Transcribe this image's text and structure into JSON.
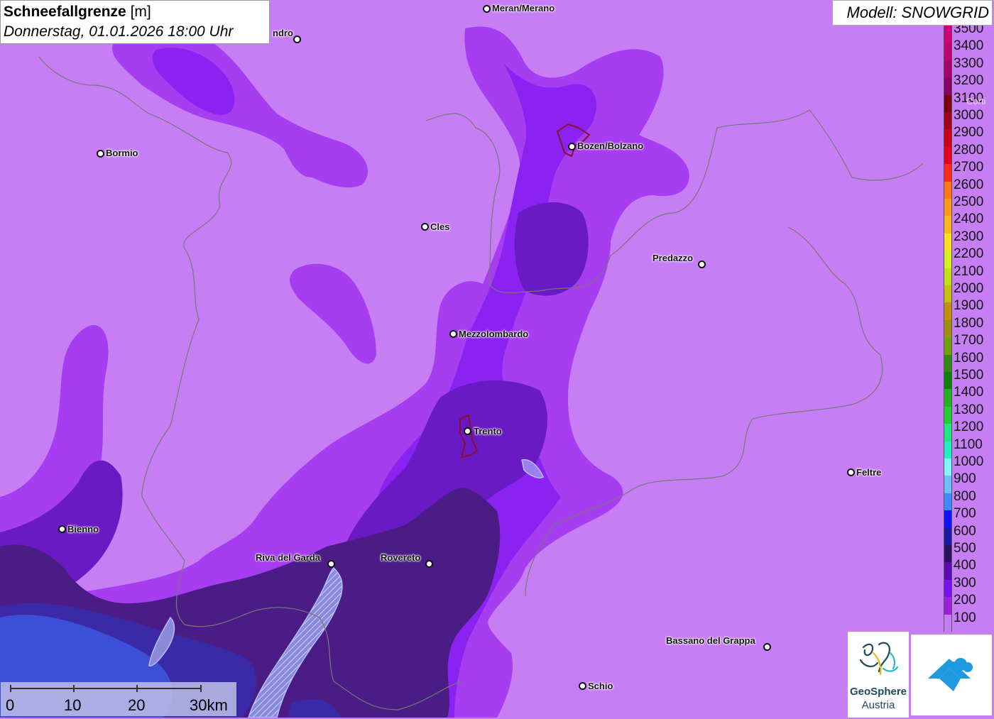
{
  "title": {
    "param_bold": "Schneefallgrenze",
    "param_unit": "[m]",
    "datetime": "Donnerstag, 01.01.2026 18:00 Uhr"
  },
  "model": "Modell: SNOWGRID",
  "legend": [
    {
      "label": "3500",
      "color": "#d1007a"
    },
    {
      "label": "3400",
      "color": "#c2006e"
    },
    {
      "label": "3300",
      "color": "#a8006a"
    },
    {
      "label": "3200",
      "color": "#8a0060"
    },
    {
      "label": "3100",
      "color": "#7a0010"
    },
    {
      "label": "3000",
      "color": "#a00018"
    },
    {
      "label": "2900",
      "color": "#c8001c"
    },
    {
      "label": "2800",
      "color": "#e60020"
    },
    {
      "label": "2700",
      "color": "#ff2a1a"
    },
    {
      "label": "2600",
      "color": "#ff7a10"
    },
    {
      "label": "2500",
      "color": "#ff9a18"
    },
    {
      "label": "2400",
      "color": "#ffb820"
    },
    {
      "label": "2300",
      "color": "#ffe020"
    },
    {
      "label": "2200",
      "color": "#d8f020"
    },
    {
      "label": "2100",
      "color": "#c0e018"
    },
    {
      "label": "2000",
      "color": "#c8c010"
    },
    {
      "label": "1900",
      "color": "#c09010"
    },
    {
      "label": "1800",
      "color": "#a09010"
    },
    {
      "label": "1700",
      "color": "#70a010"
    },
    {
      "label": "1600",
      "color": "#308a10"
    },
    {
      "label": "1500",
      "color": "#10800a"
    },
    {
      "label": "1400",
      "color": "#20b020"
    },
    {
      "label": "1300",
      "color": "#20d030"
    },
    {
      "label": "1200",
      "color": "#20e880"
    },
    {
      "label": "1100",
      "color": "#20f0c0"
    },
    {
      "label": "1000",
      "color": "#80f8ff"
    },
    {
      "label": "900",
      "color": "#70c0ff"
    },
    {
      "label": "800",
      "color": "#3a8cff"
    },
    {
      "label": "700",
      "color": "#1010ff"
    },
    {
      "label": "600",
      "color": "#1a1aa0"
    },
    {
      "label": "500",
      "color": "#2a1060"
    },
    {
      "label": "400",
      "color": "#5a0ab0"
    },
    {
      "label": "300",
      "color": "#7a10f0"
    },
    {
      "label": "200",
      "color": "#9a20e0"
    },
    {
      "label": "100",
      "color": "#c27cf4"
    }
  ],
  "cities": {
    "meran": "Meran/Merano",
    "sondrio": "ndro",
    "bozen": "Bozen/Bolzano",
    "bormio": "Bormio",
    "cles": "Cles",
    "predazzo": "Predazzo",
    "mezzolombardo": "Mezzolombardo",
    "trento": "Trento",
    "feltre": "Feltre",
    "bienno": "Bienno",
    "riva": "Riva del Garda",
    "rovereto": "Rovereto",
    "bassano": "Bassano del Grappa",
    "schio": "Schio",
    "cortina": "Corti"
  },
  "scale": {
    "l0": "0",
    "l10": "10",
    "l20": "20",
    "l30": "30km"
  },
  "logo": {
    "line1": "GeoSphere",
    "line2": "Austria"
  }
}
